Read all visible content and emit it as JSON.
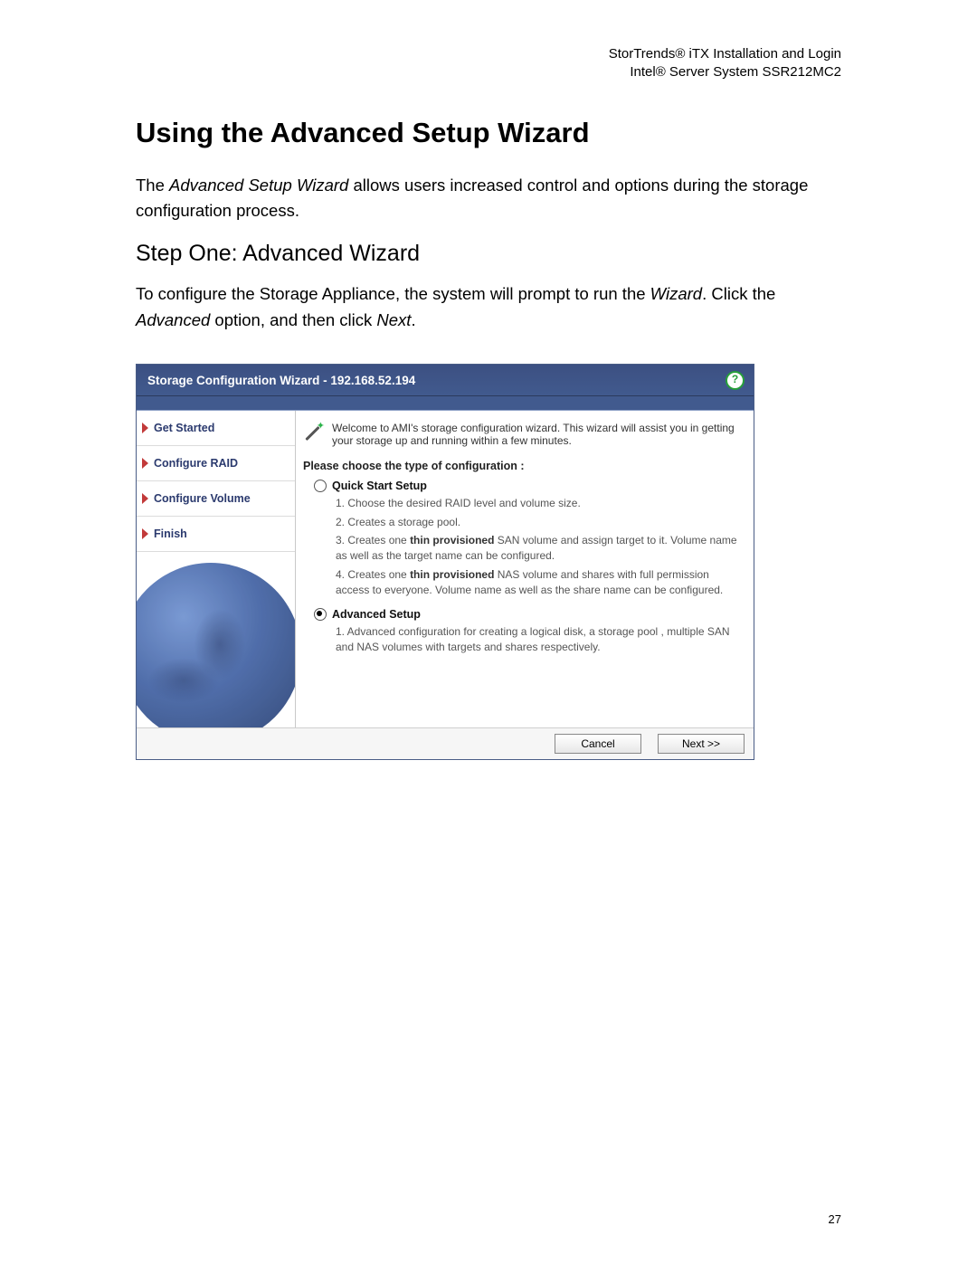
{
  "doc_header": {
    "line1": "StorTrends® iTX Installation and Login",
    "line2": "Intel® Server System SSR212MC2"
  },
  "page_number": "27",
  "h1": "Using the Advanced Setup Wizard",
  "intro_pre": "The ",
  "intro_em": "Advanced Setup Wizard",
  "intro_post": " allows users increased control and options during the storage configuration process.",
  "h2": "Step One: Advanced Wizard",
  "step_pre": "To configure the Storage Appliance, the system will prompt to run the ",
  "step_em1": "Wizard",
  "step_mid1": ". Click the ",
  "step_em2": "Advanced",
  "step_mid2": " option, and then click ",
  "step_em3": "Next",
  "step_post": ".",
  "wizard": {
    "title": "Storage Configuration Wizard - 192.168.52.194",
    "side_items": [
      "Get Started",
      "Configure RAID",
      "Configure Volume",
      "Finish"
    ],
    "welcome": "Welcome to AMI's storage configuration wizard. This wizard will assist you in getting your storage up and running within a few minutes.",
    "choose_label": "Please choose the type of configuration :",
    "quick": {
      "label": "Quick Start Setup",
      "items": [
        "1. Choose the desired RAID level and volume size.",
        "2. Creates a storage pool.",
        "3. Creates one <b>thin provisioned</b> SAN volume and assign target to it. Volume name as well as the target name can be configured.",
        "4. Creates one <b>thin provisioned</b> NAS volume and shares with full permission access to everyone. Volume name as well as the share name can be configured."
      ]
    },
    "advanced": {
      "label": "Advanced Setup",
      "items": [
        "1. Advanced configuration for creating a logical disk, a storage pool , multiple SAN and NAS volumes with targets and shares respectively."
      ]
    },
    "buttons": {
      "cancel": "Cancel",
      "next": "Next >>"
    }
  }
}
